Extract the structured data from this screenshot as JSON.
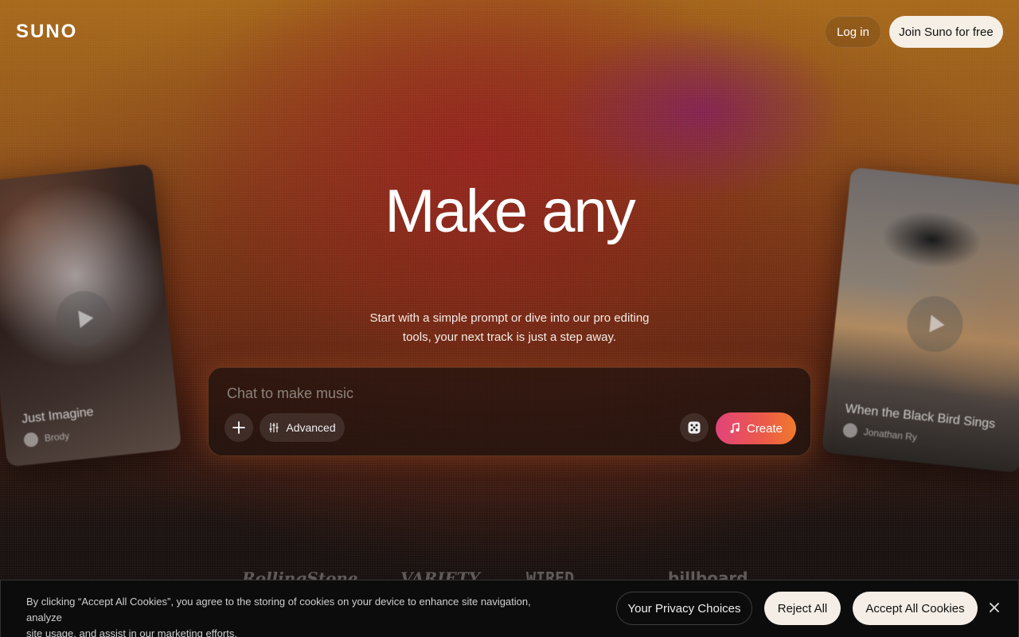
{
  "header": {
    "logo": "SUNO",
    "login_label": "Log in",
    "join_label": "Join Suno for free"
  },
  "hero": {
    "title": "Make any",
    "subtitle_line1": "Start with a simple prompt or dive into our pro editing",
    "subtitle_line2": "tools, your next track is just a step away."
  },
  "chat": {
    "placeholder": "Chat to make music",
    "plus_icon": "plus-icon",
    "advanced_label": "Advanced",
    "dice_icon": "dice-icon",
    "create_label": "Create",
    "create_gradient": [
      "#e2447a",
      "#f07a2c"
    ]
  },
  "cards": [
    {
      "title": "Just Imagine",
      "artist": "Brody"
    },
    {
      "title": "When the Black Bird Sings",
      "artist": "Jonathan Ry"
    }
  ],
  "press": [
    "RollingStone",
    "VARIETY",
    "WIRED",
    "billboard"
  ],
  "cookie": {
    "text_line1": "By clicking “Accept All Cookies”, you agree to the storing of cookies on your device to enhance site navigation, analyze",
    "text_line2": "site usage, and assist in our marketing efforts.",
    "privacy_label": "Your Privacy Choices",
    "reject_label": "Reject All",
    "accept_label": "Accept All Cookies",
    "close_icon": "close-icon"
  }
}
